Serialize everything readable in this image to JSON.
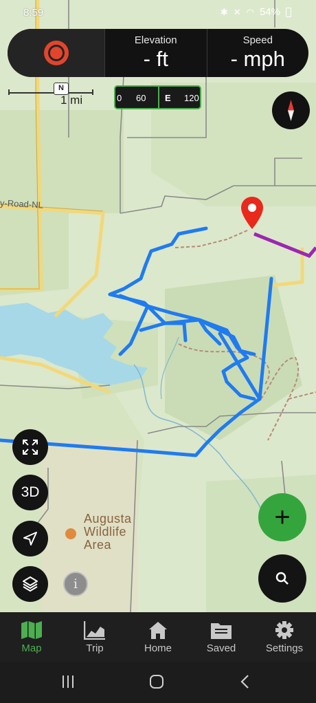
{
  "status_bar": {
    "time": "8:59",
    "battery": "54%"
  },
  "tracker": {
    "elevation": {
      "label": "Elevation",
      "value": "- ft"
    },
    "speed": {
      "label": "Speed",
      "value": "- mph"
    }
  },
  "map": {
    "scale_label": "1 mi",
    "north_label": "N",
    "heading_ticks": [
      "0",
      "60",
      "E",
      "120"
    ],
    "road_label": "y-Road-NL",
    "wildlife_area_lines": [
      "Augusta",
      "Wildlife",
      "Area"
    ]
  },
  "controls": {
    "three_d_label": "3D",
    "info_label": "i",
    "add_label": "+"
  },
  "bottom_nav": {
    "items": [
      {
        "label": "Map",
        "icon": "map-icon"
      },
      {
        "label": "Trip",
        "icon": "trip-chart-icon"
      },
      {
        "label": "Home",
        "icon": "home-icon"
      },
      {
        "label": "Saved",
        "icon": "folder-icon"
      },
      {
        "label": "Settings",
        "icon": "gear-icon"
      }
    ]
  },
  "colors": {
    "accent_green": "#4caf50",
    "track_blue": "#1f7bf0",
    "route_purple": "#9c27b0",
    "record_red": "#e2452c",
    "marker_red": "#e8291c"
  }
}
